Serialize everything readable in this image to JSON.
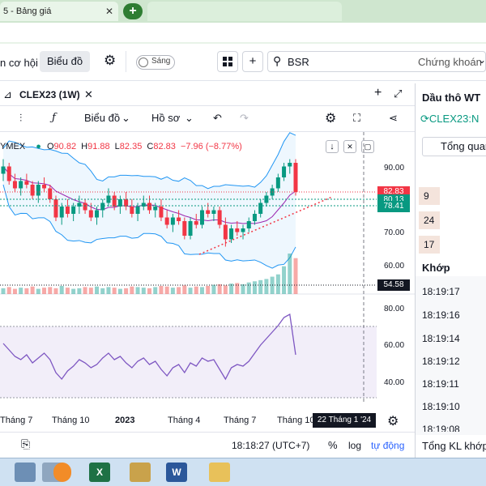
{
  "browser": {
    "tabs": [
      {
        "label": "5 - Bảng giá",
        "active": false
      },
      {
        "label": "",
        "active": true
      }
    ],
    "new_tab_label": "+"
  },
  "toolbar": {
    "left_label": "n cơ hội",
    "chart_label": "Biểu đồ",
    "theme_label": "Sáng",
    "search_value": "BSR",
    "securities_label": "Chứng khoán"
  },
  "chart_header": {
    "symbol": "CLEX23 (1W)",
    "exchange_fragment": "YMEX",
    "ohlc": {
      "o_label": "O",
      "o": "90.82",
      "h_label": "H",
      "h": "91.88",
      "l_label": "L",
      "l": "82.35",
      "c_label": "C",
      "c": "82.83",
      "change": "−7.96 (−8.77%)"
    }
  },
  "chart_tools": {
    "chart_menu": "Biểu đồ",
    "profile_menu": "Hồ sơ"
  },
  "chart_data": {
    "type": "candlestick",
    "price_axis": {
      "ticks": [
        "90.00",
        "80.00",
        "70.00",
        "60.00"
      ],
      "range": [
        55,
        95
      ]
    },
    "price_labels": [
      {
        "value": "82.83",
        "color": "#f23645"
      },
      {
        "value": "80.13",
        "color": "#089981"
      },
      {
        "value": "78.41",
        "color": "#089981"
      },
      {
        "value": "54.58",
        "color": "#131722"
      }
    ],
    "rsi_axis": {
      "ticks": [
        "80.00",
        "60.00",
        "40.00"
      ],
      "range": [
        25,
        85
      ]
    },
    "x_labels": [
      "Tháng 7",
      "Tháng 10",
      "2023",
      "Tháng 4",
      "Tháng 7",
      "Tháng 10"
    ],
    "crosshair_date": "22 Tháng 1 '24",
    "candles": [
      [
        88,
        92,
        86,
        90
      ],
      [
        90,
        91,
        85,
        86
      ],
      [
        86,
        88,
        83,
        84
      ],
      [
        84,
        87,
        82,
        86
      ],
      [
        86,
        88,
        84,
        85
      ],
      [
        85,
        86,
        81,
        82
      ],
      [
        82,
        86,
        80,
        85
      ],
      [
        85,
        87,
        83,
        84
      ],
      [
        84,
        85,
        80,
        81
      ],
      [
        81,
        82,
        75,
        76
      ],
      [
        76,
        80,
        74,
        79
      ],
      [
        79,
        81,
        76,
        77
      ],
      [
        77,
        80,
        75,
        79
      ],
      [
        79,
        82,
        77,
        80
      ],
      [
        80,
        81,
        77,
        78
      ],
      [
        78,
        80,
        75,
        76
      ],
      [
        76,
        79,
        74,
        78
      ],
      [
        78,
        81,
        76,
        80
      ],
      [
        80,
        84,
        79,
        82
      ],
      [
        82,
        83,
        78,
        79
      ],
      [
        79,
        82,
        77,
        81
      ],
      [
        81,
        83,
        78,
        79
      ],
      [
        79,
        81,
        76,
        77
      ],
      [
        77,
        80,
        75,
        79
      ],
      [
        79,
        82,
        78,
        80
      ],
      [
        80,
        82,
        77,
        78
      ],
      [
        78,
        80,
        76,
        79
      ],
      [
        79,
        81,
        75,
        76
      ],
      [
        76,
        78,
        73,
        74
      ],
      [
        74,
        77,
        72,
        76
      ],
      [
        76,
        78,
        74,
        75
      ],
      [
        75,
        76,
        70,
        71
      ],
      [
        71,
        76,
        70,
        75
      ],
      [
        75,
        77,
        73,
        74
      ],
      [
        74,
        79,
        73,
        78
      ],
      [
        78,
        80,
        76,
        77
      ],
      [
        77,
        79,
        75,
        78
      ],
      [
        78,
        79,
        73,
        74
      ],
      [
        74,
        76,
        68,
        70
      ],
      [
        70,
        74,
        69,
        73
      ],
      [
        73,
        75,
        71,
        72
      ],
      [
        72,
        74,
        70,
        73
      ],
      [
        73,
        76,
        72,
        75
      ],
      [
        75,
        78,
        74,
        77
      ],
      [
        77,
        81,
        76,
        80
      ],
      [
        80,
        83,
        79,
        82
      ],
      [
        82,
        85,
        81,
        84
      ],
      [
        84,
        88,
        83,
        87
      ],
      [
        87,
        91,
        86,
        90
      ],
      [
        90,
        92,
        88,
        91
      ],
      [
        91,
        92,
        82,
        83
      ]
    ],
    "volume": [
      10,
      12,
      9,
      11,
      10,
      13,
      9,
      11,
      12,
      10,
      14,
      11,
      9,
      10,
      12,
      11,
      13,
      10,
      12,
      11,
      9,
      10,
      13,
      12,
      11,
      10,
      12,
      14,
      13,
      11,
      12,
      15,
      11,
      13,
      12,
      14,
      16,
      17,
      15,
      18,
      19,
      17,
      20,
      22,
      24,
      26,
      30,
      34,
      48,
      70,
      62
    ],
    "rsi": [
      62,
      58,
      54,
      52,
      55,
      50,
      53,
      56,
      52,
      44,
      40,
      45,
      48,
      52,
      50,
      47,
      49,
      53,
      56,
      52,
      54,
      50,
      47,
      51,
      53,
      49,
      51,
      46,
      42,
      47,
      49,
      44,
      50,
      48,
      53,
      51,
      52,
      46,
      40,
      47,
      49,
      48,
      51,
      56,
      61,
      65,
      69,
      73,
      78,
      80,
      55
    ]
  },
  "bottom_bar": {
    "time": "18:18:27 (UTC+7)",
    "percent": "%",
    "log": "log",
    "auto": "tự động"
  },
  "right_panel": {
    "title": "Dầu thô WT",
    "symbol": "CLEX23:N",
    "overview_tab": "Tổng quan",
    "levels": [
      "9",
      "24",
      "17"
    ],
    "match_header": "Khớp",
    "times": [
      "18:19:17",
      "18:19:16",
      "18:19:14",
      "18:19:12",
      "18:19:11",
      "18:19:10",
      "18:19:08"
    ],
    "total_volume": "Tổng KL khớp"
  },
  "taskbar": {
    "icons": [
      "file-manager-icon",
      "calculator-icon",
      "media-player-icon",
      "excel-icon",
      "paint-icon",
      "word-icon",
      "folder-icon"
    ]
  }
}
